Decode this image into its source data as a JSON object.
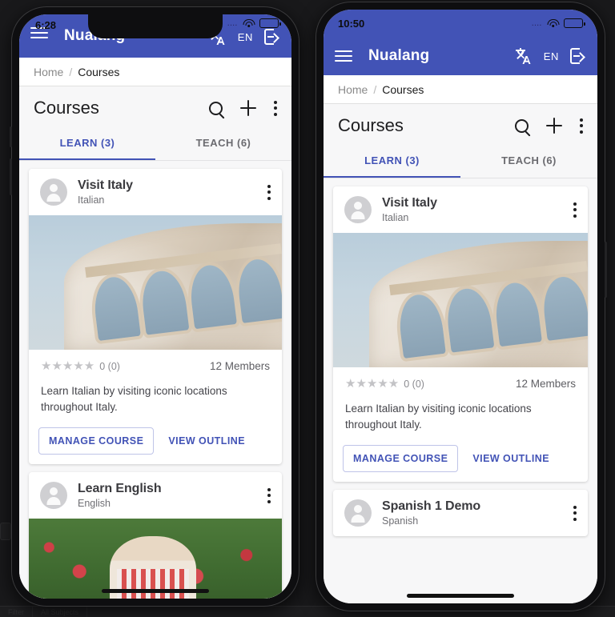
{
  "theme": {
    "brand": "#4253b6",
    "brand_alt": "#4a5ac4",
    "page_bg": "#f7f7f8"
  },
  "devices": [
    {
      "id": "left-phone",
      "status": {
        "time": "6:28",
        "signal_dots": "....",
        "wifi": "wifi-icon",
        "battery": "battery-charging-icon"
      },
      "appbar": {
        "menu": "hamburger-menu-icon",
        "title": "Nualang",
        "translate": "translate-icon",
        "language": "EN",
        "login": "login-icon"
      },
      "breadcrumb": {
        "home": "Home",
        "separator": "/",
        "current": "Courses"
      },
      "page": {
        "title": "Courses",
        "actions": {
          "search": "search-icon",
          "add": "plus-icon",
          "more": "kebab-menu-icon"
        },
        "tabs": [
          {
            "label": "LEARN (3)",
            "active": true
          },
          {
            "label": "TEACH (6)",
            "active": false
          }
        ]
      },
      "cards": [
        {
          "title": "Visit Italy",
          "subtitle": "Italian",
          "more": "kebab-menu-icon",
          "hero": "colosseum-photo",
          "stars": "★★★★★",
          "rating": "0 (0)",
          "members": "12 Members",
          "description": "Learn Italian by visiting iconic locations throughout Italy.",
          "primary_action": "MANAGE COURSE",
          "secondary_action": "VIEW OUTLINE"
        },
        {
          "title": "Learn English",
          "subtitle": "English",
          "more": "kebab-menu-icon",
          "hero": "tulip-field-photo"
        }
      ]
    },
    {
      "id": "right-phone",
      "status": {
        "time": "10:50",
        "signal_dots": "....",
        "wifi": "wifi-icon",
        "battery": "battery-full-icon"
      },
      "appbar": {
        "menu": "hamburger-menu-icon",
        "title": "Nualang",
        "translate": "translate-icon",
        "language": "EN",
        "login": "login-icon"
      },
      "breadcrumb": {
        "home": "Home",
        "separator": "/",
        "current": "Courses"
      },
      "page": {
        "title": "Courses",
        "actions": {
          "search": "search-icon",
          "add": "plus-icon",
          "more": "kebab-menu-icon"
        },
        "tabs": [
          {
            "label": "LEARN (3)",
            "active": true
          },
          {
            "label": "TEACH (6)",
            "active": false
          }
        ]
      },
      "cards": [
        {
          "title": "Visit Italy",
          "subtitle": "Italian",
          "more": "kebab-menu-icon",
          "hero": "colosseum-photo",
          "stars": "★★★★★",
          "rating": "0 (0)",
          "members": "12 Members",
          "description": "Learn Italian by visiting iconic locations throughout Italy.",
          "primary_action": "MANAGE COURSE",
          "secondary_action": "VIEW OUTLINE"
        },
        {
          "title": "Spanish 1 Demo",
          "subtitle": "Spanish",
          "more": "kebab-menu-icon"
        }
      ]
    }
  ],
  "background": {
    "ghost_filter": "Filter",
    "ghost_subject": "All Subjects"
  }
}
